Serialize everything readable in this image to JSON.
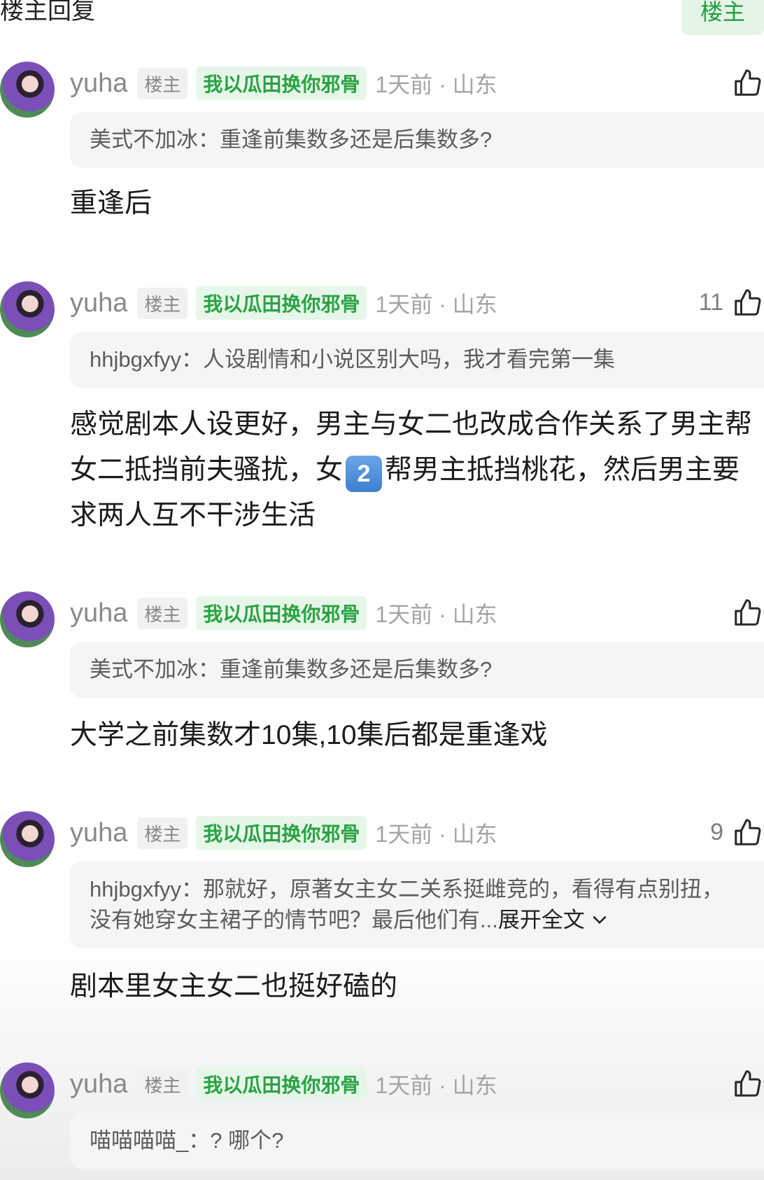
{
  "header": {
    "title": "楼主回复",
    "tab_label": "楼主"
  },
  "icons": {
    "like": "thumbs-up-icon",
    "expand": "chevron-down-icon"
  },
  "comments": [
    {
      "username": "yuha",
      "owner_badge": "楼主",
      "title_badge": "我以瓜田换你邪骨",
      "time_location": "1天前 · 山东",
      "likes": "",
      "quote_user": "美式不加冰：",
      "quote_text": "重逢前集数多还是后集数多?",
      "reply": "重逢后"
    },
    {
      "username": "yuha",
      "owner_badge": "楼主",
      "title_badge": "我以瓜田换你邪骨",
      "time_location": "1天前 · 山东",
      "likes": "11",
      "quote_user": "hhjbgxfyy：",
      "quote_text": "人设剧情和小说区别大吗，我才看完第一集",
      "reply_part1": "感觉剧本人设更好，男主与女二也改成合作关系了男主帮女二抵挡前夫骚扰，女",
      "reply_emoji": "2",
      "reply_part2": "帮男主抵挡桃花，然后男主要求两人互不干涉生活"
    },
    {
      "username": "yuha",
      "owner_badge": "楼主",
      "title_badge": "我以瓜田换你邪骨",
      "time_location": "1天前 · 山东",
      "likes": "",
      "quote_user": "美式不加冰：",
      "quote_text": "重逢前集数多还是后集数多?",
      "reply": "大学之前集数才10集,10集后都是重逢戏"
    },
    {
      "username": "yuha",
      "owner_badge": "楼主",
      "title_badge": "我以瓜田换你邪骨",
      "time_location": "1天前 · 山东",
      "likes": "9",
      "quote_user": "hhjbgxfyy：",
      "quote_text": "那就好，原著女主女二关系挺雌竞的，看得有点别扭，没有她穿女主裙子的情节吧？最后他们有...",
      "expand_label": "展开全文",
      "reply": "剧本里女主女二也挺好磕的"
    },
    {
      "username": "yuha",
      "owner_badge": "楼主",
      "title_badge": "我以瓜田换你邪骨",
      "time_location": "1天前 · 山东",
      "likes": "",
      "quote_user": "喵喵喵喵_：",
      "quote_text": "? 哪个?"
    }
  ]
}
